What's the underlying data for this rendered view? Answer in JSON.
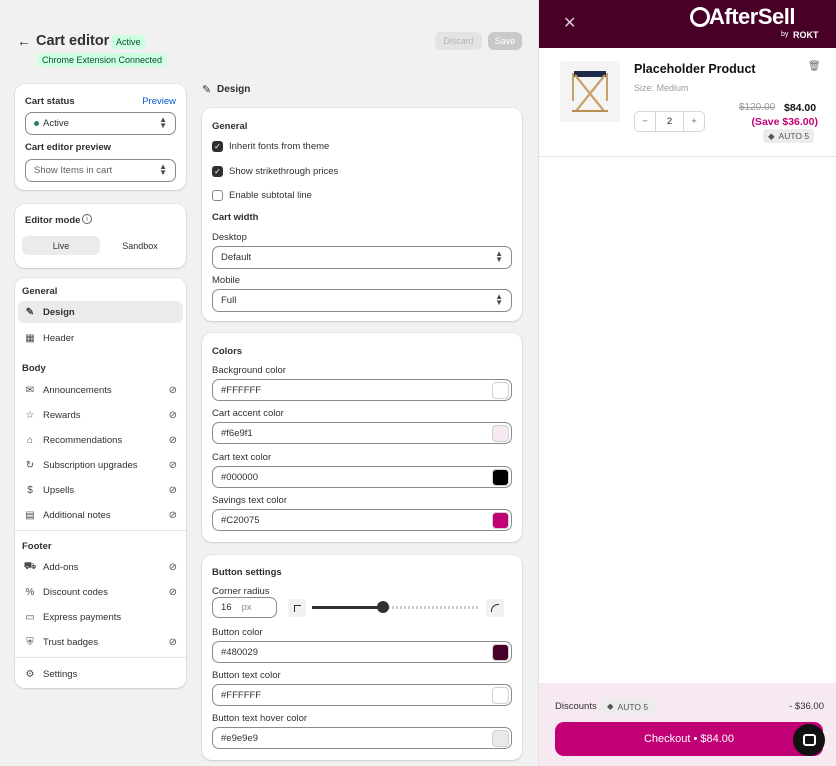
{
  "header": {
    "title": "Cart editor",
    "status_badge": "Active",
    "extension_badge": "Chrome Extension Connected",
    "discard_label": "Discard",
    "save_label": "Save"
  },
  "status_card": {
    "cart_status_label": "Cart status",
    "preview_link": "Preview",
    "cart_status_value": "Active",
    "preview_label": "Cart editor preview",
    "preview_value": "Show Items in cart"
  },
  "mode_card": {
    "label": "Editor mode",
    "live": "Live",
    "sandbox": "Sandbox"
  },
  "sidebar": {
    "general_heading": "General",
    "design": "Design",
    "header": "Header",
    "body_heading": "Body",
    "announcements": "Announcements",
    "rewards": "Rewards",
    "recommendations": "Recommendations",
    "subscription_upgrades": "Subscription upgrades",
    "upsells": "Upsells",
    "additional_notes": "Additional notes",
    "footer_heading": "Footer",
    "add_ons": "Add-ons",
    "discount_codes": "Discount codes",
    "express_payments": "Express payments",
    "trust_badges": "Trust badges",
    "settings": "Settings"
  },
  "design": {
    "section_title": "Design",
    "general": {
      "title": "General",
      "inherit_fonts": "Inherit fonts from theme",
      "strikethrough": "Show strikethrough prices",
      "subtotal": "Enable subtotal line",
      "cart_width": "Cart width",
      "desktop_label": "Desktop",
      "desktop_value": "Default",
      "mobile_label": "Mobile",
      "mobile_value": "Full"
    },
    "colors": {
      "title": "Colors",
      "bg_label": "Background color",
      "bg_value": "#FFFFFF",
      "accent_label": "Cart accent color",
      "accent_value": "#f6e9f1",
      "text_label": "Cart text color",
      "text_value": "#000000",
      "savings_label": "Savings text color",
      "savings_value": "#C20075"
    },
    "buttons": {
      "title": "Button settings",
      "radius_label": "Corner radius",
      "radius_value": "16",
      "radius_unit": "px",
      "radius_fraction": 0.42,
      "btn_color_label": "Button color",
      "btn_color_value": "#480029",
      "btn_text_label": "Button text color",
      "btn_text_value": "#FFFFFF",
      "btn_hover_label": "Button text hover color",
      "btn_hover_value": "#e9e9e9"
    }
  },
  "preview": {
    "brand": "AfterSell",
    "brand_sub": "by",
    "brand_partner": "ROKT",
    "product_name": "Placeholder Product",
    "product_variant": "Size: Medium",
    "quantity": "2",
    "qty_minus": "−",
    "qty_plus": "+",
    "old_price": "$120.00",
    "new_price": "$84.00",
    "savings": "(Save $36.00)",
    "discount_tag": "AUTO 5",
    "discounts_label": "Discounts",
    "discounts_tag": "AUTO 5",
    "discounts_amount": "- $36.00",
    "checkout": "Checkout • $84.00"
  },
  "colors": {
    "header_bg": "#480029",
    "accent": "#c20075",
    "accent_bg": "#f6e9f1"
  }
}
